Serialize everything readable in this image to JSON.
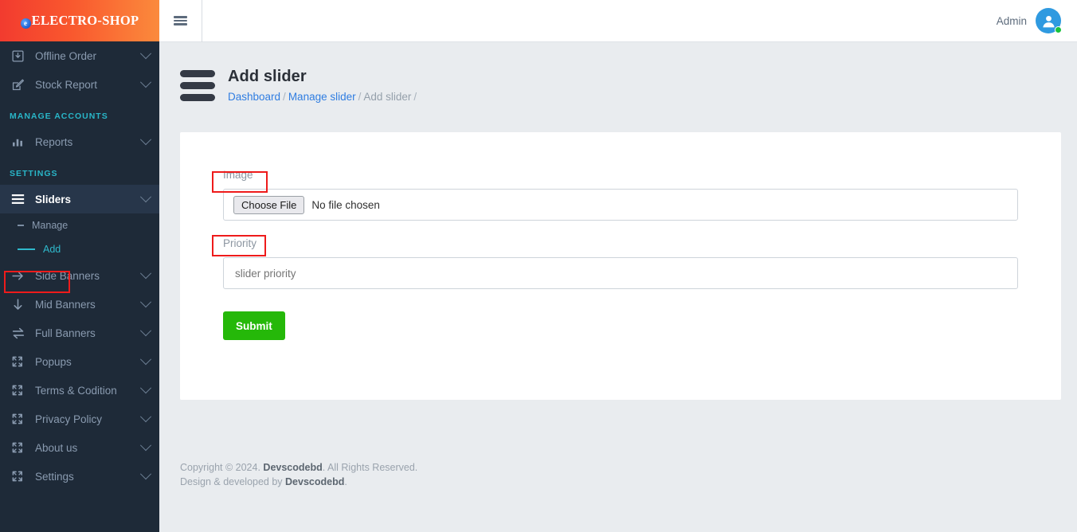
{
  "brand": {
    "logo_text": "ELECTRO-SHOP",
    "logo_mark": "e",
    "gradient_from": "#f23b2f",
    "gradient_to": "#fb8a3c"
  },
  "sidebar": {
    "bg_color": "#1e2a38",
    "accent_color": "#2fb9cc",
    "top_items": [
      {
        "label": "Offline Order",
        "icon": "download-box-icon",
        "has_chevron": true
      },
      {
        "label": "Stock Report",
        "icon": "pencil-square-icon",
        "has_chevron": true
      }
    ],
    "sections": [
      {
        "title": "MANAGE ACCOUNTS",
        "items": [
          {
            "label": "Reports",
            "icon": "bar-chart-icon",
            "has_chevron": true
          }
        ]
      },
      {
        "title": "SETTINGS",
        "items": [
          {
            "label": "Sliders",
            "icon": "menu-bars-icon",
            "has_chevron": true,
            "active": true
          },
          {
            "label": "Side Banners",
            "icon": "arrow-right-icon",
            "has_chevron": true
          },
          {
            "label": "Mid Banners",
            "icon": "arrow-down-icon",
            "has_chevron": true
          },
          {
            "label": "Full Banners",
            "icon": "arrows-exchange-icon",
            "has_chevron": true
          },
          {
            "label": "Popups",
            "icon": "expand-icon",
            "has_chevron": true
          },
          {
            "label": "Terms & Codition",
            "icon": "expand-icon",
            "has_chevron": true
          },
          {
            "label": "Privacy Policy",
            "icon": "expand-icon",
            "has_chevron": true
          },
          {
            "label": "About us",
            "icon": "expand-icon",
            "has_chevron": true
          },
          {
            "label": "Settings",
            "icon": "expand-icon",
            "has_chevron": true
          }
        ]
      }
    ],
    "sliders_submenu": [
      {
        "label": "Manage",
        "current": false
      },
      {
        "label": "Add",
        "current": true
      }
    ]
  },
  "topbar": {
    "toggle_icon": "hamburger-icon",
    "user_name": "Admin",
    "avatar_icon": "user-avatar-icon",
    "status": "online"
  },
  "page": {
    "title": "Add slider",
    "breadcrumb": [
      {
        "label": "Dashboard",
        "link": true
      },
      {
        "label": "Manage slider",
        "link": true
      },
      {
        "label": "Add slider",
        "link": false
      }
    ],
    "breadcrumb_separator": "/"
  },
  "form": {
    "image_label": "Image",
    "file_button": "Choose File",
    "file_status": "No file chosen",
    "priority_label": "Priority",
    "priority_value": "",
    "priority_placeholder": "slider priority",
    "submit_label": "Submit",
    "submit_color": "#25b809"
  },
  "annotations": {
    "highlight_color": "#ee1b1b",
    "boxes": [
      "sidebar-add-item",
      "image-label",
      "priority-label"
    ]
  },
  "footer": {
    "line1_pre": "Copyright © 2024. ",
    "line1_brand": "Devscodebd",
    "line1_post": ". All Rights Reserved.",
    "line2_pre": "Design & developed by ",
    "line2_brand": "Devscodebd",
    "line2_post": "."
  }
}
